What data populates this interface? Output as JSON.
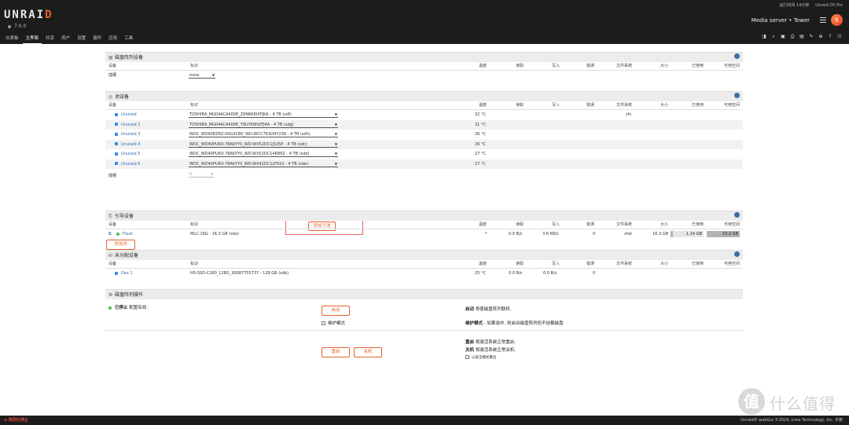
{
  "header": {
    "logo_main": "UNRAI",
    "logo_accent": "D",
    "version": "7.0.0",
    "uptime": "运行时间 14分钟",
    "edition": "Unraid OS Pro",
    "server_name": "Media server",
    "server_sep": "•",
    "server_host": "Tower",
    "nav": [
      "仪表板",
      "主界面",
      "共享",
      "用户",
      "设置",
      "插件",
      "应用",
      "工具"
    ],
    "tool_icons": [
      "◨",
      "⌕",
      "▣",
      "⎙",
      "▤",
      "✎",
      "⊕",
      "?",
      "⏻"
    ]
  },
  "columns": {
    "device": "设备",
    "identity": "标识",
    "temp": "温度",
    "reads": "读取",
    "writes": "写入",
    "errors": "错误",
    "fs": "文件系统",
    "size": "大小",
    "used": "已使用",
    "free": "可用空间"
  },
  "array_devices": {
    "title": "磁盘阵列设备",
    "slots_label": "插槽",
    "slots_value": "none"
  },
  "pool_devices": {
    "title": "池设备",
    "rows": [
      {
        "name": "Unuraid",
        "id": "TOSHIBA_MG04ACA400E_Z9N6K8IXFJKA - 4 TB (sdf)",
        "temp": "32 °C",
        "fs": "zfs"
      },
      {
        "name": "Unuraid 2",
        "id": "TOSHIBA_MG04ACA400E_Y9UYK9H2FJKA - 4 TB (sdg)",
        "temp": "31 °C",
        "fs": ""
      },
      {
        "name": "Unuraid 3",
        "id": "WDC_WD40EZRZ-00GXCB0_WD-WCC7K3UHY236 - 4 TB (sdh)",
        "temp": "26 °C",
        "fs": ""
      },
      {
        "name": "Unuraid 4",
        "id": "WDC_WD40PURX-78AKYY0_WD-WX52DC1JS35P - 4 TB (sdc)",
        "temp": "26 °C",
        "fs": ""
      },
      {
        "name": "Unuraid 5",
        "id": "WDC_WD40PURX-78AKYY0_WD-WX52DC14R86Z - 4 TB (sdd)",
        "temp": "27 °C",
        "fs": ""
      },
      {
        "name": "Unuraid 6",
        "id": "WDC_WD40PURX-78AKYY0_WD-WX42DC1LFS10 - 4 TB (sde)",
        "temp": "27 °C",
        "fs": ""
      }
    ],
    "slots_label": "插槽",
    "slots_value": "6",
    "add_subpool": "添加子池",
    "add_pool": "添加池"
  },
  "boot_device": {
    "title": "引导设备",
    "name": "Flash",
    "id": "MLC-16G - 16.3 GB (sda)",
    "temp": "*",
    "reads": "0.0 B/s",
    "writes": "3.8 KB/s",
    "errors": "0",
    "fs": "vfat",
    "size": "16.3 GB",
    "used": "1.14 GB",
    "free": "15.2 GB",
    "used_fraction": 0.07
  },
  "unassigned": {
    "title": "未分配设备",
    "name": "Dev 1",
    "id": "HS-SSD-C260_128G_30087755737 - 128 GB (sdb)",
    "temp": "25 °C",
    "reads": "0.0 B/s",
    "writes": "0.0 B/s",
    "errors": "0"
  },
  "operations": {
    "title": "磁盘阵列操作",
    "status_strong": "已停止",
    "status_rest": "配置有效.",
    "start_btn": "启动",
    "start_desc_b": "启动",
    "start_desc": "将使磁盘阵列联机.",
    "maint_label": "维护模式",
    "maint_desc_b": "维护模式",
    "maint_desc": "- 如果选中, 则启动磁盘阵列但不挂载磁盘",
    "reboot_btn": "重启",
    "shutdown_btn": "关机",
    "reboot_desc_b": "重启",
    "reboot_desc": "将激活系统正常重启.",
    "shutdown_desc_b": "关机",
    "shutdown_desc": "将激活系统正常关机.",
    "safe_mode": "以安全模式重启"
  },
  "footer": {
    "stopped": "阵列已停止",
    "copyright": "Unraid® webGui ©2024, Lime Technology, Inc.",
    "manual": "手册"
  },
  "watermark": {
    "glyph": "值",
    "text": "什么值得买"
  }
}
